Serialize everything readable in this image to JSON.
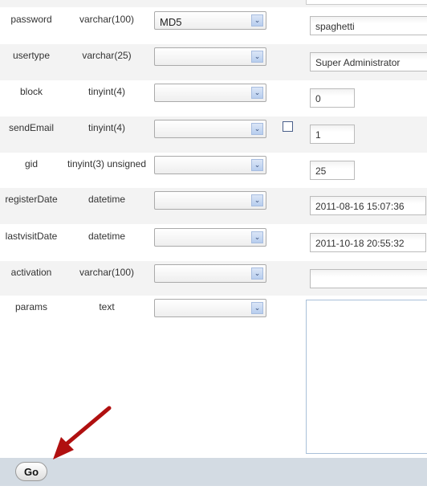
{
  "rows": [
    {
      "name": "password",
      "type": "varchar(100)",
      "function": "MD5",
      "value": "spaghetti",
      "size": "long"
    },
    {
      "name": "usertype",
      "type": "varchar(25)",
      "function": "",
      "value": "Super Administrator",
      "size": "long"
    },
    {
      "name": "block",
      "type": "tinyint(4)",
      "function": "",
      "value": "0",
      "size": "short"
    },
    {
      "name": "sendEmail",
      "type": "tinyint(4)",
      "function": "",
      "value": "1",
      "size": "short",
      "null_checkbox": false
    },
    {
      "name": "gid",
      "type": "tinyint(3) unsigned",
      "function": "",
      "value": "25",
      "size": "short"
    },
    {
      "name": "registerDate",
      "type": "datetime",
      "function": "",
      "value": "2011-08-16 15:07:36",
      "size": "date"
    },
    {
      "name": "lastvisitDate",
      "type": "datetime",
      "function": "",
      "value": "2011-10-18 20:55:32",
      "size": "date"
    },
    {
      "name": "activation",
      "type": "varchar(100)",
      "function": "",
      "value": "",
      "size": "long"
    },
    {
      "name": "params",
      "type": "text",
      "function": "",
      "value": "",
      "size": "textarea"
    }
  ],
  "footer": {
    "go_label": "Go"
  },
  "annotation": {
    "arrow_color": "#b01010",
    "points_to": "go-button"
  }
}
